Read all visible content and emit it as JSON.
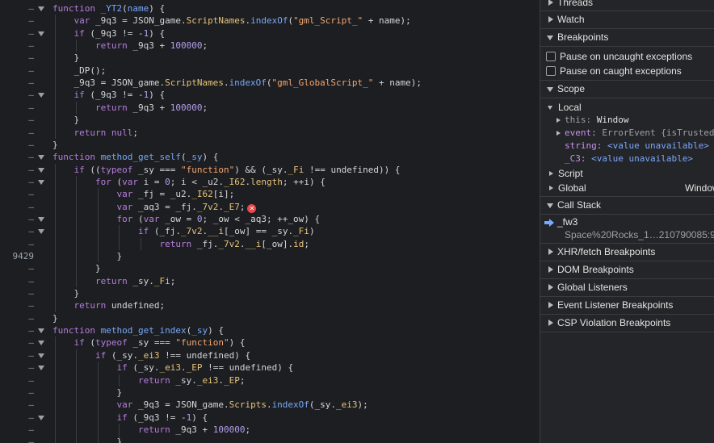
{
  "editor": {
    "lines": [
      {
        "gutter": "–",
        "fold": true,
        "html": "<span class=\"kw\">function</span> <span class=\"fn\">_YT2</span>(<span class=\"fn\">name</span>) {"
      },
      {
        "gutter": "–",
        "fold": false,
        "html": "    <span class=\"kw\">var</span> _9q3 = JSON_game.<span class=\"prop\">ScriptNames</span>.<span class=\"fn\">indexOf</span>(<span class=\"str\">\"gml_Script_\"</span> + name);"
      },
      {
        "gutter": "–",
        "fold": true,
        "html": "    <span class=\"kw\">if</span> (_9q3 != -<span class=\"num2\">1</span>) {"
      },
      {
        "gutter": "–",
        "fold": false,
        "html": "        <span class=\"kw\">return</span> _9q3 + <span class=\"num2\">100000</span>;"
      },
      {
        "gutter": "–",
        "fold": false,
        "html": "    }"
      },
      {
        "gutter": "–",
        "fold": false,
        "html": "    _DP();"
      },
      {
        "gutter": "–",
        "fold": false,
        "html": "    _9q3 = JSON_game.<span class=\"prop\">ScriptNames</span>.<span class=\"fn\">indexOf</span>(<span class=\"str\">\"gml_GlobalScript_\"</span> + name);"
      },
      {
        "gutter": "–",
        "fold": true,
        "html": "    <span class=\"kw\">if</span> (_9q3 != -<span class=\"num2\">1</span>) {"
      },
      {
        "gutter": "–",
        "fold": false,
        "html": "        <span class=\"kw\">return</span> _9q3 + <span class=\"num2\">100000</span>;"
      },
      {
        "gutter": "–",
        "fold": false,
        "html": "    }"
      },
      {
        "gutter": "–",
        "fold": false,
        "html": "    <span class=\"kw\">return</span> <span class=\"kw\">null</span>;"
      },
      {
        "gutter": "–",
        "fold": false,
        "html": "}"
      },
      {
        "gutter": "–",
        "fold": true,
        "html": "<span class=\"kw\">function</span> <span class=\"fn\">method_get_self</span>(<span class=\"fn\">_sy</span>) {"
      },
      {
        "gutter": "–",
        "fold": true,
        "html": "    <span class=\"kw\">if</span> ((<span class=\"kw\">typeof</span> _sy === <span class=\"str\">\"function\"</span>) && (_sy.<span class=\"prop\">_Fi</span> !== undefined)) {"
      },
      {
        "gutter": "–",
        "fold": true,
        "html": "        <span class=\"kw\">for</span> (<span class=\"kw\">var</span> i = <span class=\"num2\">0</span>; i < _u2.<span class=\"prop\">_I62</span>.<span class=\"prop\">length</span>; ++i) {"
      },
      {
        "gutter": "–",
        "fold": false,
        "html": "            <span class=\"kw\">var</span> _fj = _u2.<span class=\"prop\">_I62</span>[i];"
      },
      {
        "gutter": "–",
        "fold": false,
        "html": "            <span class=\"kw\">var</span> _aq3 = _fj.<span class=\"prop\">_7v2</span>.<span class=\"prop\">_E7</span>;<span class=\"err\">✕</span>"
      },
      {
        "gutter": "–",
        "fold": true,
        "html": "            <span class=\"kw\">for</span> (<span class=\"kw\">var</span> _ow = <span class=\"num2\">0</span>; _ow < _aq3; ++_ow) {"
      },
      {
        "gutter": "–",
        "fold": true,
        "html": "                <span class=\"kw\">if</span> (_fj.<span class=\"prop\">_7v2</span>.<span class=\"prop\">__i</span>[_ow] == _sy.<span class=\"prop\">_Fi</span>)"
      },
      {
        "gutter": "–",
        "fold": false,
        "html": "                    <span class=\"kw\">return</span> _fj.<span class=\"prop\">_7v2</span>.<span class=\"prop\">__i</span>[_ow].<span class=\"prop\">id</span>;"
      },
      {
        "gutter": "9429",
        "fold": false,
        "html": "            }"
      },
      {
        "gutter": "–",
        "fold": false,
        "html": "        }"
      },
      {
        "gutter": "–",
        "fold": false,
        "html": "        <span class=\"kw\">return</span> _sy.<span class=\"prop\">_Fi</span>;"
      },
      {
        "gutter": "–",
        "fold": false,
        "html": "    }"
      },
      {
        "gutter": "–",
        "fold": false,
        "html": "    <span class=\"kw\">return</span> undefined;"
      },
      {
        "gutter": "–",
        "fold": false,
        "html": "}"
      },
      {
        "gutter": "–",
        "fold": true,
        "html": "<span class=\"kw\">function</span> <span class=\"fn\">method_get_index</span>(<span class=\"fn\">_sy</span>) {"
      },
      {
        "gutter": "–",
        "fold": true,
        "html": "    <span class=\"kw\">if</span> (<span class=\"kw\">typeof</span> _sy === <span class=\"str\">\"function\"</span>) {"
      },
      {
        "gutter": "–",
        "fold": true,
        "html": "        <span class=\"kw\">if</span> (_sy.<span class=\"prop\">_ei3</span> !== undefined) {"
      },
      {
        "gutter": "–",
        "fold": true,
        "html": "            <span class=\"kw\">if</span> (_sy.<span class=\"prop\">_ei3</span>.<span class=\"prop\">_EP</span> !== undefined) {"
      },
      {
        "gutter": "–",
        "fold": false,
        "html": "                <span class=\"kw\">return</span> _sy.<span class=\"prop\">_ei3</span>.<span class=\"prop\">_EP</span>;"
      },
      {
        "gutter": "–",
        "fold": false,
        "html": "            }"
      },
      {
        "gutter": "–",
        "fold": false,
        "html": "            <span class=\"kw\">var</span> _9q3 = JSON_game.<span class=\"prop\">Scripts</span>.<span class=\"fn\">indexOf</span>(_sy.<span class=\"prop\">_ei3</span>);"
      },
      {
        "gutter": "–",
        "fold": true,
        "html": "            <span class=\"kw\">if</span> (_9q3 != -<span class=\"num2\">1</span>) {"
      },
      {
        "gutter": "–",
        "fold": false,
        "html": "                <span class=\"kw\">return</span> _9q3 + <span class=\"num2\">100000</span>;"
      },
      {
        "gutter": "–",
        "fold": false,
        "html": "            }"
      }
    ]
  },
  "debugger": {
    "threads": "Threads",
    "watch": "Watch",
    "breakpoints": "Breakpoints",
    "pause_uncaught": "Pause on uncaught exceptions",
    "pause_caught": "Pause on caught exceptions",
    "scope": "Scope",
    "local": "Local",
    "this_key": "this:",
    "this_val": "Window",
    "event_key": "event:",
    "event_val": "ErrorEvent {isTrusted",
    "string_key": "string:",
    "string_val": "<value unavailable>",
    "c3_key": "_C3:",
    "c3_val": "<value unavailable>",
    "script": "Script",
    "global": "Global",
    "global_val": "Window",
    "call_stack": "Call Stack",
    "frame_name": "_fw3",
    "frame_file": "Space%20Rocks_1…210790085:9",
    "xhr": "XHR/fetch Breakpoints",
    "dom": "DOM Breakpoints",
    "global_listeners": "Global Listeners",
    "event_listener": "Event Listener Breakpoints",
    "csp": "CSP Violation Breakpoints"
  }
}
